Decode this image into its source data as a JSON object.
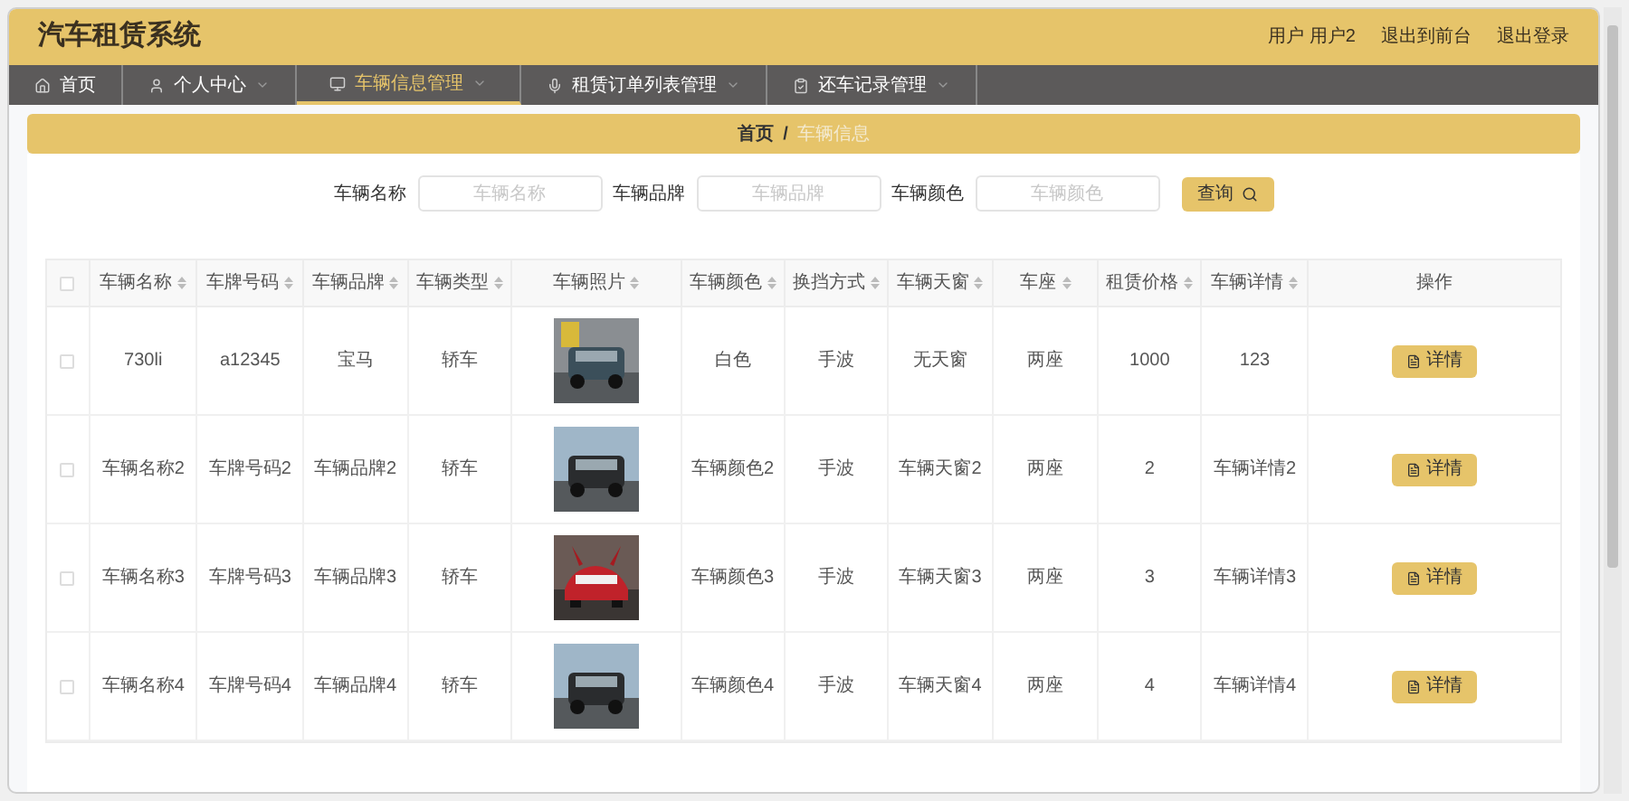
{
  "header": {
    "title": "汽车租赁系统",
    "links": [
      "用户 用户2",
      "退出到前台",
      "退出登录"
    ]
  },
  "nav": [
    {
      "label": "首页",
      "dropdown": false,
      "selected": false
    },
    {
      "label": "个人中心",
      "dropdown": true,
      "selected": false
    },
    {
      "label": "车辆信息管理",
      "dropdown": true,
      "selected": true
    },
    {
      "label": "租赁订单列表管理",
      "dropdown": true,
      "selected": false
    },
    {
      "label": "还车记录管理",
      "dropdown": true,
      "selected": false
    }
  ],
  "breadcrumb": {
    "items": [
      "首页",
      "车辆信息"
    ],
    "separator": "/"
  },
  "select_all": {
    "checked": false
  },
  "search": {
    "fields": [
      {
        "label": "车辆名称",
        "placeholder": "车辆名称"
      },
      {
        "label": "车辆品牌",
        "placeholder": "车辆品牌"
      },
      {
        "label": "车辆颜色",
        "placeholder": "车辆颜色"
      }
    ],
    "button": "查询"
  },
  "table": {
    "columns": [
      {
        "label": "车辆名称",
        "sortable": true
      },
      {
        "label": "车牌号码",
        "sortable": true
      },
      {
        "label": "车辆品牌",
        "sortable": true
      },
      {
        "label": "车辆类型",
        "sortable": true
      },
      {
        "label": "车辆照片",
        "sortable": true
      },
      {
        "label": "车辆颜色",
        "sortable": true
      },
      {
        "label": "换挡方式",
        "sortable": true
      },
      {
        "label": "车辆天窗",
        "sortable": true
      },
      {
        "label": "车座",
        "sortable": true
      },
      {
        "label": "租赁价格",
        "sortable": true
      },
      {
        "label": "车辆详情",
        "sortable": true
      },
      {
        "label": "操作",
        "sortable": false
      }
    ],
    "rows": [
      {
        "checked": false,
        "cells": [
          "730li",
          "a12345",
          "宝马",
          "轿车",
          {
            "kind": "picture"
          },
          "白色",
          "手波",
          "无天窗",
          "两座",
          "1000",
          "123"
        ],
        "action": "详情"
      },
      {
        "checked": false,
        "cells": [
          "车辆名称2",
          "车牌号码2",
          "车辆品牌2",
          "轿车",
          {
            "kind": "picture"
          },
          "车辆颜色2",
          "手波",
          "车辆天窗2",
          "两座",
          "2",
          "车辆详情2"
        ],
        "action": "详情"
      },
      {
        "checked": false,
        "cells": [
          "车辆名称3",
          "车牌号码3",
          "车辆品牌3",
          "轿车",
          {
            "kind": "picture"
          },
          "车辆颜色3",
          "手波",
          "车辆天窗3",
          "两座",
          "3",
          "车辆详情3"
        ],
        "action": "详情"
      },
      {
        "checked": false,
        "cells": [
          "车辆名称4",
          "车牌号码4",
          "车辆品牌4",
          "轿车",
          {
            "kind": "picture"
          },
          "车辆颜色4",
          "手波",
          "车辆天窗4",
          "两座",
          "4",
          "车辆详情4"
        ],
        "action": "详情"
      }
    ]
  }
}
